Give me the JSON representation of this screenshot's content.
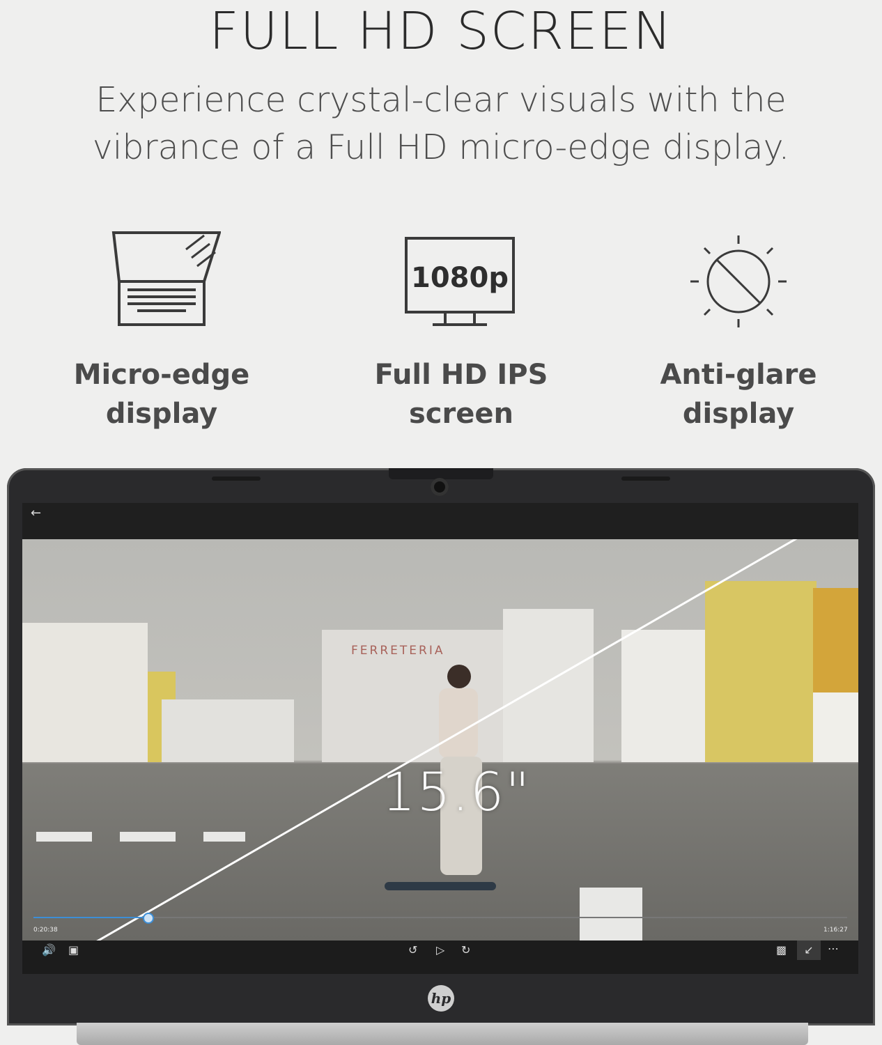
{
  "headline": "FULL HD SCREEN",
  "subtitle_line1": "Experience crystal-clear visuals with the",
  "subtitle_line2": "vibrance of a Full HD micro-edge display.",
  "features": [
    {
      "icon": "laptop-micro-edge-icon",
      "line1": "Micro-edge",
      "line2": "display"
    },
    {
      "icon": "monitor-1080p-icon",
      "badge": "1080p",
      "line1": "Full HD IPS",
      "line2": "screen"
    },
    {
      "icon": "anti-glare-sun-icon",
      "line1": "Anti-glare",
      "line2": "display"
    }
  ],
  "screen": {
    "diagonal": "15.6\"",
    "sign_text": "FERRETERIA",
    "elapsed": "0:20:38",
    "remaining": "1:16:27",
    "progress_fraction": 0.14
  },
  "brand": "hp"
}
